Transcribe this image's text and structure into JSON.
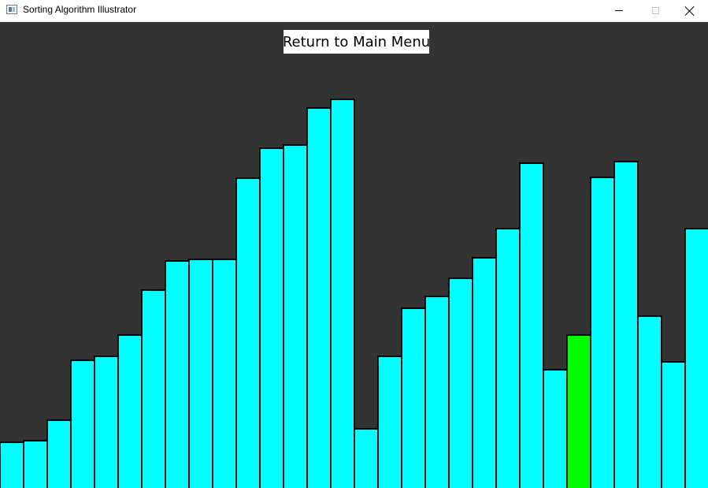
{
  "window": {
    "title": "Sorting Algorithm Illustrator",
    "controls": {
      "minimize": "—",
      "maximize": "☐",
      "close": "✕"
    }
  },
  "menu_button": {
    "label": "Return to Main Menu"
  },
  "colors": {
    "background": "#333333",
    "bar_default": "#00ffff",
    "bar_highlight": "#00ff00",
    "bar_border": "#000000"
  },
  "bars": {
    "max_value": 591,
    "highlight_index": 24,
    "values": [
      59,
      61,
      87,
      163,
      168,
      195,
      252,
      289,
      291,
      291,
      394,
      432,
      436,
      483,
      494,
      76,
      168,
      229,
      244,
      267,
      293,
      330,
      413,
      151,
      195,
      395,
      415,
      219,
      161,
      330
    ]
  }
}
